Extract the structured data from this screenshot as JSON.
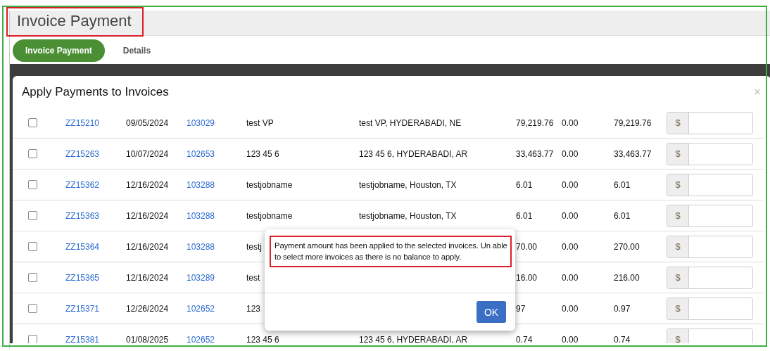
{
  "page": {
    "title": "Invoice Payment"
  },
  "tabs": [
    {
      "label": "Invoice Payment",
      "selected": true
    },
    {
      "label": "Details",
      "selected": false
    }
  ],
  "modal": {
    "title": "Apply Payments to Invoices",
    "close": "×",
    "rows": [
      {
        "checked": false,
        "column_1": "ZZ15210",
        "column_2": "09/05/2024",
        "column_3": "103029",
        "column_4": "test VP",
        "column_5": "test VP, HYDERABADI, NE",
        "column_6": "79,219.76",
        "column_7": "0.00",
        "column_8": "79,219.76",
        "currency": "$"
      },
      {
        "checked": false,
        "column_1": "ZZ15263",
        "column_2": "10/07/2024",
        "column_3": "102653",
        "column_4": "123 45 6",
        "column_5": "123 45 6, HYDERABADI, AR",
        "column_6": "33,463.77",
        "column_7": "0.00",
        "column_8": "33,463.77",
        "currency": "$"
      },
      {
        "checked": false,
        "column_1": "ZZ15362",
        "column_2": "12/16/2024",
        "column_3": "103288",
        "column_4": "testjobname",
        "column_5": "testjobname, Houston, TX",
        "column_6": "6.01",
        "column_7": "0.00",
        "column_8": "6.01",
        "currency": "$"
      },
      {
        "checked": false,
        "column_1": "ZZ15363",
        "column_2": "12/16/2024",
        "column_3": "103288",
        "column_4": "testjobname",
        "column_5": "testjobname, Houston, TX",
        "column_6": "6.01",
        "column_7": "0.00",
        "column_8": "6.01",
        "currency": "$"
      },
      {
        "checked": false,
        "column_1": "ZZ15364",
        "column_2": "12/16/2024",
        "column_3": "103288",
        "column_4": "testj",
        "column_6": "70.00",
        "column_7": "0.00",
        "column_8": "270.00",
        "currency": "$"
      },
      {
        "checked": false,
        "column_1": "ZZ15365",
        "column_2": "12/16/2024",
        "column_3": "103289",
        "column_4": "test",
        "column_6": "16.00",
        "column_7": "0.00",
        "column_8": "216.00",
        "currency": "$"
      },
      {
        "checked": false,
        "column_1": "ZZ15371",
        "column_2": "12/26/2024",
        "column_3": "102652",
        "column_4": "123",
        "column_6": "97",
        "column_7": "0.00",
        "column_8": "0.97",
        "currency": "$"
      },
      {
        "checked": false,
        "column_1": "ZZ15381",
        "column_2": "01/08/2025",
        "column_3": "102652",
        "column_4": "123 45 6",
        "column_5": "123 45 6, HYDERABADI, AR",
        "column_6": "0.74",
        "column_7": "0.00",
        "column_8": "0.74",
        "currency": "$"
      }
    ]
  },
  "dialog": {
    "message": "Payment amount has been applied to the selected invoices. Un able to select more invoices as there is no balance to apply.",
    "button": "OK"
  }
}
